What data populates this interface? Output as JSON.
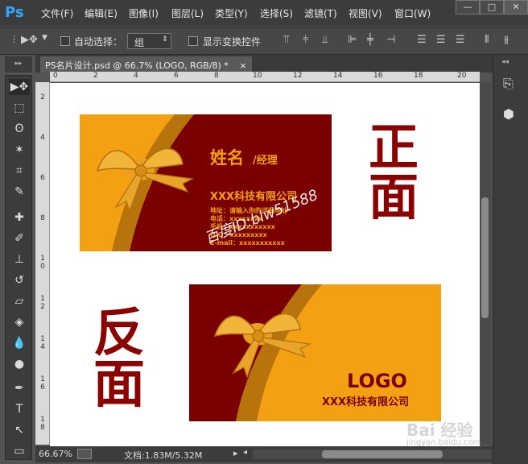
{
  "app": {
    "logo": "Ps"
  },
  "menu": [
    "文件(F)",
    "编辑(E)",
    "图像(I)",
    "图层(L)",
    "类型(Y)",
    "选择(S)",
    "滤镜(T)",
    "视图(V)",
    "窗口(W)"
  ],
  "window_controls": {
    "minimize": "—",
    "restore": "□",
    "close": "✕"
  },
  "options": {
    "auto_select_label": "自动选择：",
    "auto_select_value": "组",
    "show_transform_label": "显示变换控件"
  },
  "document": {
    "tab_title": "PS名片设计.psd @ 66.7% (LOGO, RGB/8) *",
    "tab_close": "×"
  },
  "ruler_top": [
    "0",
    "2",
    "4",
    "6",
    "8",
    "10",
    "12",
    "14",
    "16",
    "18",
    "20"
  ],
  "ruler_left": [
    "2",
    "4",
    "6",
    "8",
    "1 0",
    "1 2",
    "1 4",
    "1 6",
    "1 8"
  ],
  "status": {
    "zoom": "66.67%",
    "doc_info": "文档:1.83M/5.32M"
  },
  "artwork": {
    "front_label": [
      "正",
      "面"
    ],
    "back_label": [
      "反",
      "面"
    ],
    "front_card": {
      "name": "姓名",
      "title": "/经理",
      "company": "XXX科技有限公司",
      "lines": [
        "地址：请输入你的详细地址",
        "电话：xxxxxxxx",
        "手机：xxxxxxxxxxx",
        "Q Q：xxxxxxxxx",
        "E-mail：xxxxxxxxxxx"
      ],
      "overlay": "百度ID:blw51588"
    },
    "back_card": {
      "logo": "LOGO",
      "company": "XXX科技有限公司"
    }
  },
  "watermark": {
    "text": "Bai 经验",
    "sub": "jingyan.baidu.com"
  },
  "colors": {
    "card_red": "#7a0000",
    "card_gold": "#f3a012",
    "label_red": "#8b0000",
    "ps_blue": "#31a8ff"
  }
}
